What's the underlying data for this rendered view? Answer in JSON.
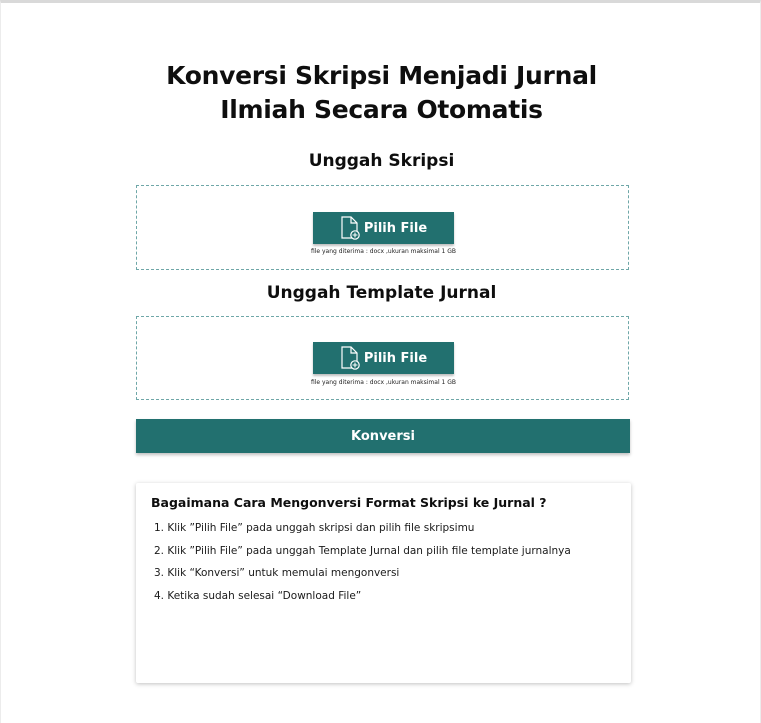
{
  "page": {
    "title_line1": "Konversi Skripsi Menjadi Jurnal",
    "title_line2": "Ilmiah Secara Otomatis"
  },
  "upload_thesis": {
    "title": "Unggah Skripsi",
    "button_label": "Pilih File",
    "hint": "file yang diterima : docx ,ukuran maksimal 1 GB"
  },
  "upload_template": {
    "title": "Unggah Template Jurnal",
    "button_label": "Pilih File",
    "hint": "file yang diterima : docx ,ukuran maksimal 1 GB"
  },
  "convert": {
    "label": "Konversi"
  },
  "help": {
    "title": "Bagaimana Cara Mengonversi Format Skripsi ke Jurnal ?",
    "steps": [
      "1. Klik ”Pilih File” pada unggah skripsi dan pilih file skripsimu",
      "2. Klik ”Pilih File” pada unggah Template Jurnal dan pilih file template jurnalnya",
      "3. Klik “Konversi” untuk memulai mengonversi",
      "4. Ketika sudah selesai “Download File”"
    ]
  },
  "colors": {
    "accent": "#22706f",
    "dashed_border": "#6fa7a8",
    "text": "#0e0e0e"
  },
  "icons": {
    "pick_file": "file-add-icon"
  }
}
